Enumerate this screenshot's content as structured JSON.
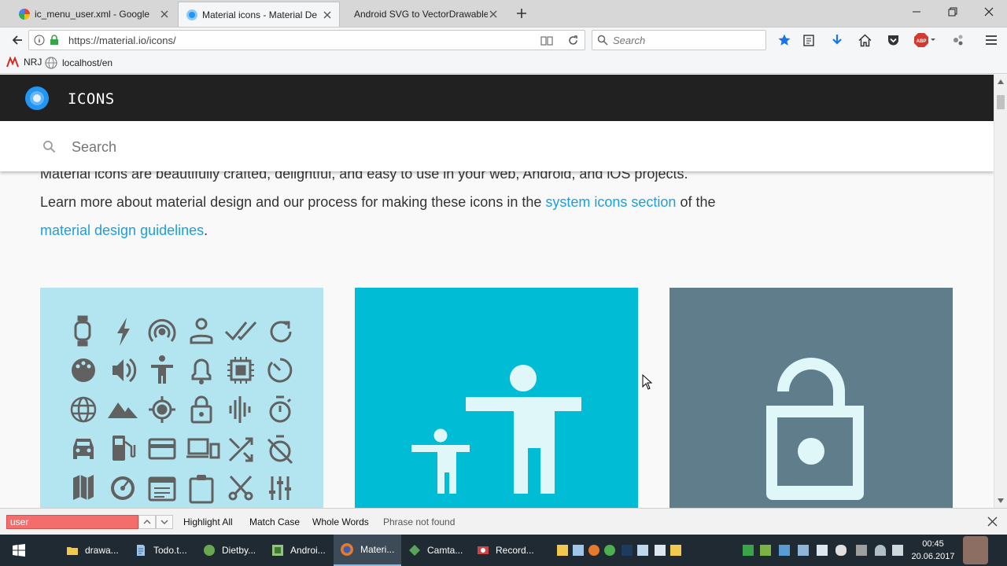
{
  "browser": {
    "tabs": [
      {
        "title": "ic_menu_user.xml - Google",
        "active": false
      },
      {
        "title": "Material icons - Material De",
        "active": true
      },
      {
        "title": "Android SVG to VectorDrawable",
        "active": false
      }
    ],
    "url": "https://material.io/icons/",
    "search_placeholder": "Search",
    "bookmarks": [
      {
        "label": "NRJ"
      },
      {
        "label": "localhost/en"
      }
    ],
    "adblock_label": "ABP"
  },
  "page": {
    "site_title": "ICONS",
    "search_placeholder": "Search",
    "intro": {
      "line0": "Material icons are beautifully crafted, delightful, and easy to use in your web, Android, and iOS projects.",
      "line1_prefix": "Learn more about material design and our process for making these icons in the",
      "link1": "system icons section",
      "line1_suffix": "of the",
      "link2": "material design guidelines",
      "line2_suffix": "."
    },
    "colors": {
      "header_bg": "#212121",
      "link": "#1e9fd9",
      "card_light_blue": "#b3e5f0",
      "card_cyan": "#00bcd4",
      "card_blue_grey": "#607d8b",
      "icon_grey": "#616161"
    },
    "card_icons": [
      "watch-icon",
      "flash-icon",
      "wifi-tethering-icon",
      "person-outline-icon",
      "done-all-icon",
      "refresh-icon",
      "palette-icon",
      "volume-up-icon",
      "accessibility-icon",
      "notifications-icon",
      "memory-icon",
      "av-timer-icon",
      "language-icon",
      "landscape-icon",
      "gps-fixed-icon",
      "lock-icon",
      "graphic-eq-icon",
      "timer-icon",
      "directions-car-icon",
      "local-gas-station-icon",
      "credit-card-icon",
      "devices-icon",
      "shuffle-icon",
      "timer-off-icon",
      "map-icon",
      "speedometer-icon",
      "event-note-icon",
      "assignment-icon",
      "content-cut-icon",
      "tune-icon"
    ]
  },
  "findbar": {
    "query": "user",
    "highlight_all": "Highlight All",
    "match_case": "Match Case",
    "whole_words": "Whole Words",
    "status": "Phrase not found"
  },
  "taskbar": {
    "items": [
      {
        "label": "drawa...",
        "color": "#f2c94c",
        "active": false
      },
      {
        "label": "Todo.t...",
        "color": "#9fc5e8",
        "active": false
      },
      {
        "label": "Dietby...",
        "color": "#6aa84f",
        "active": false
      },
      {
        "label": "Androi...",
        "color": "#93c47d",
        "active": false
      },
      {
        "label": "Materi...",
        "color": "#e8792b",
        "active": true
      },
      {
        "label": "Camta...",
        "color": "#5aa35a",
        "active": false
      },
      {
        "label": "Record...",
        "color": "#cc4444",
        "active": false
      }
    ],
    "time": "00:45",
    "date": "20.06.2017"
  }
}
